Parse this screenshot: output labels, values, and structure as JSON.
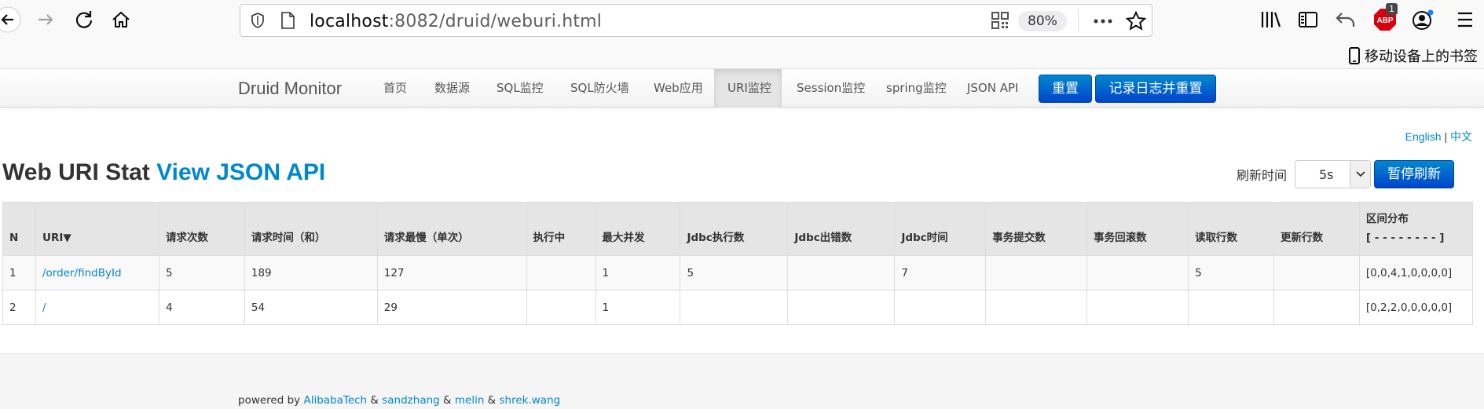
{
  "browser": {
    "url_host": "localhost",
    "url_rest": ":8082/druid/weburi.html",
    "zoom": "80%",
    "abp_badge": "1",
    "bookmark_label": "移动设备上的书签"
  },
  "navbar": {
    "brand": "Druid Monitor",
    "items": [
      {
        "label": "首页"
      },
      {
        "label": "数据源"
      },
      {
        "label": "SQL监控"
      },
      {
        "label": "SQL防火墙"
      },
      {
        "label": "Web应用"
      },
      {
        "label": "URI监控"
      },
      {
        "label": "Session监控"
      },
      {
        "label": "spring监控"
      },
      {
        "label": "JSON API"
      }
    ],
    "reset_label": "重置",
    "log_reset_label": "记录日志并重置"
  },
  "lang": {
    "english": "English",
    "sep": "|",
    "chinese": "中文"
  },
  "title": {
    "main": "Web URI Stat",
    "link": "View JSON API"
  },
  "refresh": {
    "label": "刷新时间",
    "value": "5s",
    "pause_label": "暂停刷新"
  },
  "table": {
    "headers": [
      "N",
      "URI▼",
      "请求次数",
      "请求时间（和）",
      "请求最慢（单次）",
      "执行中",
      "最大并发",
      "Jdbc执行数",
      "Jdbc出错数",
      "Jdbc时间",
      "事务提交数",
      "事务回滚数",
      "读取行数",
      "更新行数",
      "区间分布",
      "[ - - - - - - - - ]"
    ],
    "rows": [
      [
        "1",
        "/order/findById",
        "5",
        "189",
        "127",
        "",
        "1",
        "5",
        "",
        "7",
        "",
        "",
        "5",
        "",
        "[0,0,4,1,0,0,0,0]"
      ],
      [
        "2",
        "/",
        "4",
        "54",
        "29",
        "",
        "1",
        "",
        "",
        "",
        "",
        "",
        "",
        "",
        "[0,2,2,0,0,0,0,0]"
      ]
    ]
  },
  "footer": {
    "prefix": "powered by",
    "author1": "AlibabaTech",
    "amp": "&",
    "author2": "sandzhang",
    "author3": "melin",
    "author4": "shrek.wang"
  },
  "colors": {
    "link": "#0088cc",
    "primary_button": "#0055cc",
    "abp_red": "#d8000c"
  }
}
